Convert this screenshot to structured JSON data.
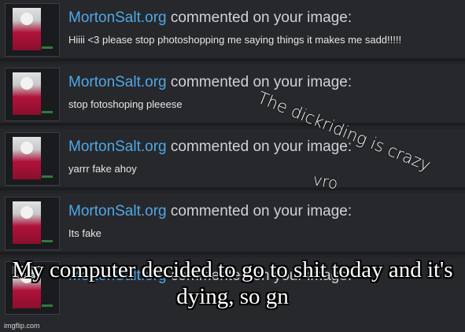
{
  "notifications": [
    {
      "user": "MortonSalt.org",
      "action": "commented on your image:",
      "comment": "Hiiii <3 please stop photoshopping me saying things it makes me sadd!!!!!"
    },
    {
      "user": "MortonSalt.org",
      "action": "commented on your image:",
      "comment": "stop fotoshoping pleeese"
    },
    {
      "user": "MortonSalt.org",
      "action": "commented on your image:",
      "comment": "yarrr fake ahoy"
    },
    {
      "user": "MortonSalt.org",
      "action": "commented on your image:",
      "comment": "Its fake"
    },
    {
      "user": "MortonSalt.org",
      "action": "commented on your image:",
      "comment": ""
    }
  ],
  "handwritten": {
    "line1": "The dickriding is crazy",
    "line2": "vro"
  },
  "caption": "My computer decided to go to shit today and it's dying, so gn",
  "watermark": "imgflip.com",
  "colors": {
    "username": "#4fa8e6",
    "background": "#26282c"
  }
}
